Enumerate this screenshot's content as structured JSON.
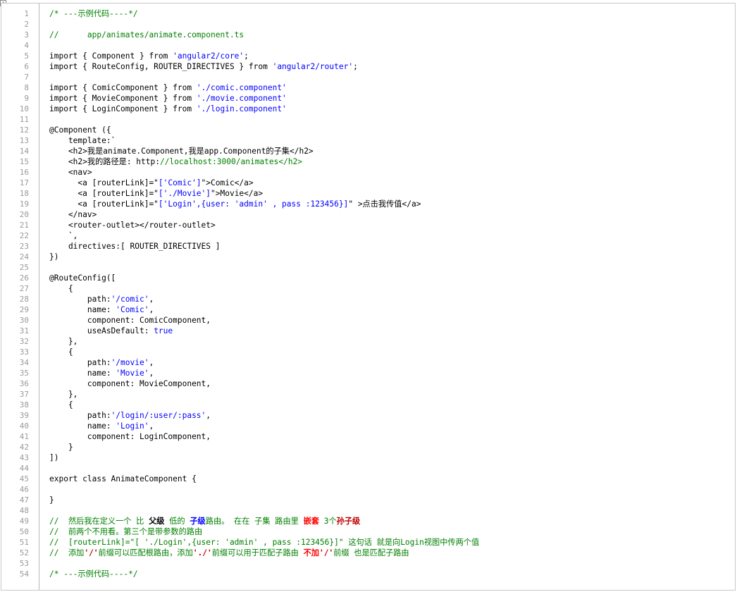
{
  "window": {
    "corner_glyph": "↕"
  },
  "editor": {
    "lines": [
      [
        [
          "comment",
          "/* ---示例代码----*/"
        ]
      ],
      [],
      [
        [
          "comment",
          "//      app/animates/animate.component.ts"
        ]
      ],
      [],
      [
        [
          "plain",
          "import { Component } from "
        ],
        [
          "string",
          "'angular2/core'"
        ],
        [
          "plain",
          ";"
        ]
      ],
      [
        [
          "plain",
          "import { RouteConfig, ROUTER_DIRECTIVES } from "
        ],
        [
          "string",
          "'angular2/router'"
        ],
        [
          "plain",
          ";"
        ]
      ],
      [],
      [
        [
          "plain",
          "import { ComicComponent } from "
        ],
        [
          "string",
          "'./comic.component'"
        ]
      ],
      [
        [
          "plain",
          "import { MovieComponent } from "
        ],
        [
          "string",
          "'./movie.component'"
        ]
      ],
      [
        [
          "plain",
          "import { LoginComponent } from "
        ],
        [
          "string",
          "'./login.component'"
        ]
      ],
      [],
      [
        [
          "plain",
          "@Component ({"
        ]
      ],
      [
        [
          "plain",
          "    template:`"
        ]
      ],
      [
        [
          "plain",
          "    <h2>我是animate.Component,我是app.Component的子集</h2>"
        ]
      ],
      [
        [
          "plain",
          "    <h2>我的路径是: http:"
        ],
        [
          "comment",
          "//localhost:3000/animates</h2>"
        ]
      ],
      [
        [
          "plain",
          "    <nav>"
        ]
      ],
      [
        [
          "plain",
          "      <a [routerLink]=\""
        ],
        [
          "string",
          "['Comic']"
        ],
        [
          "plain",
          "\">Comic</a>"
        ]
      ],
      [
        [
          "plain",
          "      <a [routerLink]=\""
        ],
        [
          "string",
          "['./Movie']"
        ],
        [
          "plain",
          "\">Movie</a>"
        ]
      ],
      [
        [
          "plain",
          "      <a [routerLink]=\""
        ],
        [
          "string",
          "['Login',{user: 'admin' , pass :123456}]"
        ],
        [
          "plain",
          "\" >点击我传值</a>"
        ]
      ],
      [
        [
          "plain",
          "    </nav>"
        ]
      ],
      [
        [
          "plain",
          "    <router-outlet></router-outlet>"
        ]
      ],
      [
        [
          "plain",
          "    `,"
        ]
      ],
      [
        [
          "plain",
          "    directives:[ ROUTER_DIRECTIVES ]"
        ]
      ],
      [
        [
          "plain",
          "})"
        ]
      ],
      [],
      [
        [
          "plain",
          "@RouteConfig(["
        ]
      ],
      [
        [
          "plain",
          "    {"
        ]
      ],
      [
        [
          "plain",
          "        path:"
        ],
        [
          "string",
          "'/comic'"
        ],
        [
          "plain",
          ","
        ]
      ],
      [
        [
          "plain",
          "        name: "
        ],
        [
          "string",
          "'Comic'"
        ],
        [
          "plain",
          ","
        ]
      ],
      [
        [
          "plain",
          "        component: ComicComponent,"
        ]
      ],
      [
        [
          "plain",
          "        useAsDefault: "
        ],
        [
          "keyword",
          "true"
        ]
      ],
      [
        [
          "plain",
          "    },"
        ]
      ],
      [
        [
          "plain",
          "    {"
        ]
      ],
      [
        [
          "plain",
          "        path:"
        ],
        [
          "string",
          "'/movie'"
        ],
        [
          "plain",
          ","
        ]
      ],
      [
        [
          "plain",
          "        name: "
        ],
        [
          "string",
          "'Movie'"
        ],
        [
          "plain",
          ","
        ]
      ],
      [
        [
          "plain",
          "        component: MovieComponent,"
        ]
      ],
      [
        [
          "plain",
          "    },"
        ]
      ],
      [
        [
          "plain",
          "    {"
        ]
      ],
      [
        [
          "plain",
          "        path:"
        ],
        [
          "string",
          "'/login/:user/:pass'"
        ],
        [
          "plain",
          ","
        ]
      ],
      [
        [
          "plain",
          "        name: "
        ],
        [
          "string",
          "'Login'"
        ],
        [
          "plain",
          ","
        ]
      ],
      [
        [
          "plain",
          "        component: LoginComponent,"
        ]
      ],
      [
        [
          "plain",
          "    }"
        ]
      ],
      [
        [
          "plain",
          "])"
        ]
      ],
      [],
      [
        [
          "plain",
          "export class AnimateComponent {"
        ]
      ],
      [],
      [
        [
          "plain",
          "}"
        ]
      ],
      [],
      [
        [
          "comment",
          "//  然后我在定义一个 比 "
        ],
        [
          "bold",
          "父级"
        ],
        [
          "comment",
          " 低的 "
        ],
        [
          "blue",
          "子级"
        ],
        [
          "comment",
          "路由。 在在 子集 路由里 "
        ],
        [
          "red",
          "嵌套"
        ],
        [
          "comment",
          " 3个"
        ],
        [
          "darkred",
          "孙子级"
        ]
      ],
      [
        [
          "comment",
          "//  前两个不用看。第三个是带参数的路由"
        ]
      ],
      [
        [
          "comment",
          "//  [routerLink]=\"[ './Login',{user: 'admin' , pass :123456}]\" 这句话 就是向Login视图中传两个值"
        ]
      ],
      [
        [
          "comment",
          "//  添加"
        ],
        [
          "darkred",
          "'/'"
        ],
        [
          "comment",
          "前缀可以匹配根路由，添加"
        ],
        [
          "darkred",
          "'./'"
        ],
        [
          "comment",
          "前缀可以用于匹配子路由 "
        ],
        [
          "red",
          "不加"
        ],
        [
          "darkred",
          "'/'"
        ],
        [
          "comment",
          "前缀 也是匹配子路由"
        ]
      ],
      [],
      [
        [
          "comment",
          "/* ---示例代码----*/"
        ]
      ]
    ]
  }
}
